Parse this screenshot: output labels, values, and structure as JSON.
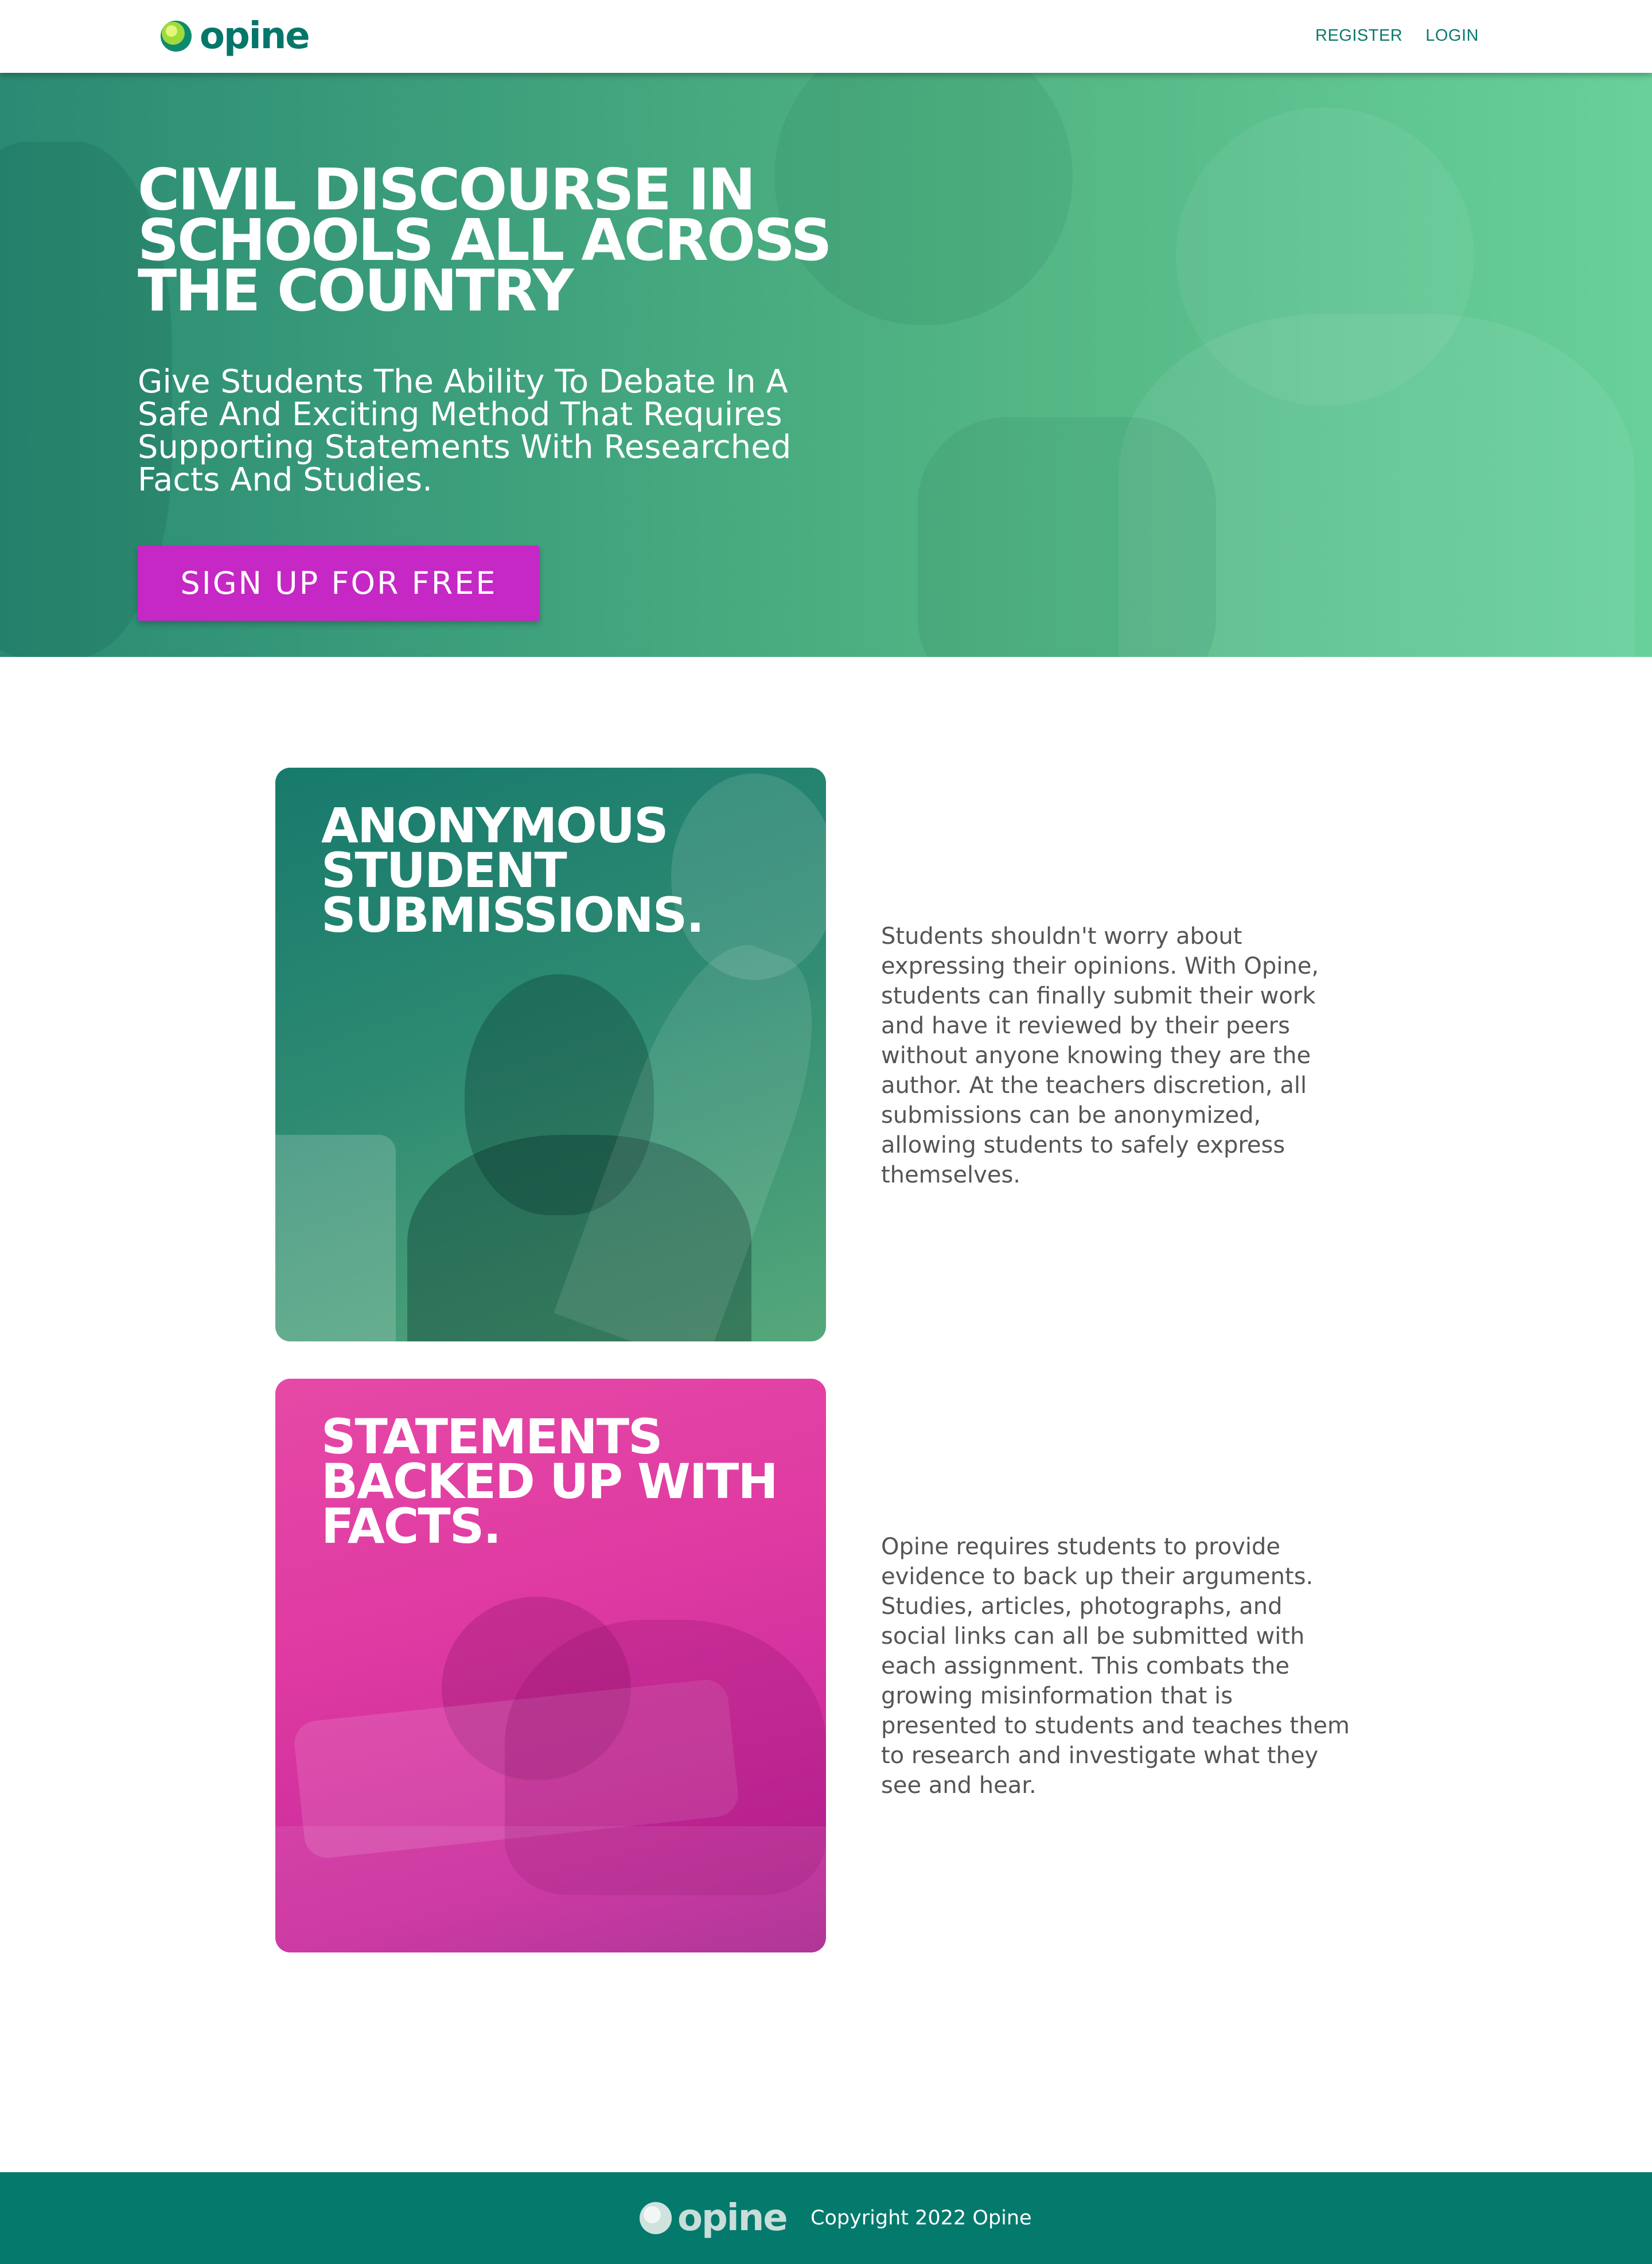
{
  "brand": {
    "name": "opine",
    "accent": "#05766a",
    "cta_color": "#c528c4"
  },
  "nav": {
    "register": "REGISTER",
    "login": "LOGIN"
  },
  "hero": {
    "title": "CIVIL DISCOURSE IN SCHOOLS ALL ACROSS THE COUNTRY",
    "subtitle": "Give Students The Ability To Debate In A Safe And Exciting Method That Requires Supporting Statements With Researched Facts And Studies.",
    "cta": "SIGN UP FOR FREE"
  },
  "features": [
    {
      "title": "ANONYMOUS STUDENT SUBMISSIONS.",
      "text": "Students shouldn't worry about expressing their opinions. With Opine, students can finally submit their work and have it reviewed by their peers without anyone knowing they are the author. At the teachers discretion, all submissions can be anonymized, allowing students to safely express themselves."
    },
    {
      "title": "STATEMENTS BACKED UP WITH FACTS.",
      "text": "Opine requires students to provide evidence to back up their arguments. Studies, articles, photographs, and social links can all be submitted with each assignment. This combats the growing misinformation that is presented to students and teaches them to research and investigate what they see and hear."
    }
  ],
  "footer": {
    "copyright": "Copyright 2022 Opine"
  }
}
